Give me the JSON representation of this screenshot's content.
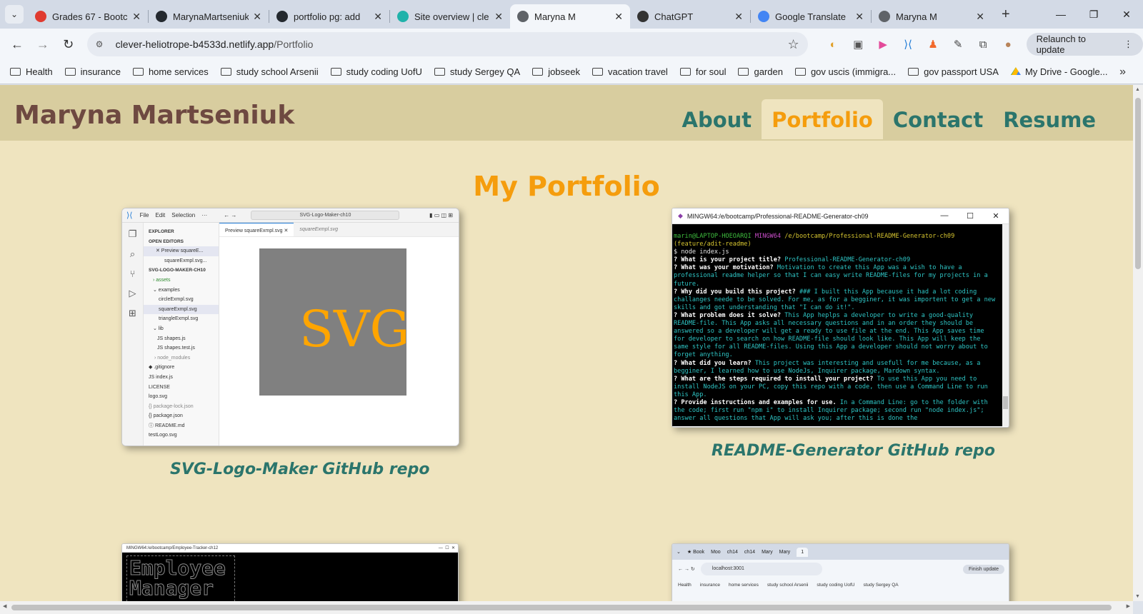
{
  "browser": {
    "tabs": [
      {
        "title": "Grades 67 - Bootc",
        "favicon_color": "#e03a2f",
        "active": false
      },
      {
        "title": "MarynaMartseniuk",
        "favicon_color": "#24292f",
        "active": false
      },
      {
        "title": "portfolio pg: add",
        "favicon_color": "#24292f",
        "active": false
      },
      {
        "title": "Site overview | cle",
        "favicon_color": "#20b2aa",
        "active": false
      },
      {
        "title": "Maryna M",
        "favicon_color": "#5f6368",
        "active": true
      },
      {
        "title": "ChatGPT",
        "favicon_color": "#333333",
        "active": false
      },
      {
        "title": "Google Translate",
        "favicon_color": "#4285f4",
        "active": false
      },
      {
        "title": "Maryna M",
        "favicon_color": "#5f6368",
        "active": false
      }
    ],
    "new_tab_icon": "plus-icon",
    "window_controls": {
      "minimize": "—",
      "restore": "❐",
      "close": "✕"
    },
    "url_host": "clever-heliotrope-b4533d.netlify.app",
    "url_path": "/Portfolio",
    "relaunch_label": "Relaunch to update",
    "bookmarks": [
      {
        "label": "Health",
        "type": "folder"
      },
      {
        "label": "insurance",
        "type": "folder"
      },
      {
        "label": "home services",
        "type": "folder"
      },
      {
        "label": "study school Arsenii",
        "type": "folder"
      },
      {
        "label": "study coding UofU",
        "type": "folder"
      },
      {
        "label": "study Sergey QA",
        "type": "folder"
      },
      {
        "label": "jobseek",
        "type": "folder"
      },
      {
        "label": "vacation travel",
        "type": "folder"
      },
      {
        "label": "for soul",
        "type": "folder"
      },
      {
        "label": "garden",
        "type": "folder"
      },
      {
        "label": "gov uscis (immigra...",
        "type": "folder"
      },
      {
        "label": "gov passport USA",
        "type": "folder"
      },
      {
        "label": "My Drive - Google...",
        "type": "drive"
      }
    ]
  },
  "site": {
    "name": "Maryna Martseniuk",
    "nav": [
      {
        "label": "About",
        "active": false
      },
      {
        "label": "Portfolio",
        "active": true
      },
      {
        "label": "Contact",
        "active": false
      },
      {
        "label": "Resume",
        "active": false
      }
    ],
    "page_title": "My Portfolio",
    "colors": {
      "header_bg": "#d8cd9f",
      "page_bg": "#efe4bf",
      "accent": "#f59d0d",
      "teal": "#2b756c",
      "name": "#6e4941"
    },
    "projects": [
      {
        "caption": "SVG-Logo-Maker GitHub repo",
        "vscode": {
          "menu": [
            "File",
            "Edit",
            "Selection",
            "···"
          ],
          "search": "SVG-Logo-Maker-ch10",
          "tab_active": "Preview squareExmpl.svg",
          "tab_inactive": "squareExmpl.svg",
          "explorer": [
            "EXPLORER",
            "OPEN EDITORS",
            "✕ Preview squareE...",
            "squareExmpl.svg...",
            "SVG-LOGO-MAKER-CH10",
            "› assets",
            "⌄ examples",
            "circleExmpl.svg",
            "squareExmpl.svg",
            "triangleExmpl.svg",
            "⌄ lib",
            "JS shapes.js",
            "JS shapes.test.js",
            "› node_modules",
            "◆ .gitignore",
            "JS index.js",
            "LICENSE",
            "logo.svg",
            "{} package-lock.json",
            "{} package.json",
            "ⓘ README.md",
            "testLogo.svg"
          ],
          "preview_text": "SVG"
        }
      },
      {
        "caption": "README-Generator GitHub repo",
        "terminal": {
          "title": "MINGW64:/e/bootcamp/Professional-README-Generator-ch09",
          "prompt_user": "marin@LAPTOP-HOEOARQI",
          "prompt_env": "MINGW64",
          "prompt_path": "/e/bootcamp/Professional-README-Generator-ch09 (feature/adit-readme)",
          "command": "$ node index.js",
          "qa": [
            {
              "q": "? What is your project title?",
              "a": "Professional-README-Generator-ch09"
            },
            {
              "q": "? What was your motivation?",
              "a": "Motivation to create this App was a wish to have a professional readme helper so that I can easy write README-files for my projects in a future."
            },
            {
              "q": "? Why did you build this project?",
              "a": "### I built this App because it had a lot coding challanges neede to be solved. For me, as for a begginer, it was importent to get a new skills and got understanding that \"I can do it!\"."
            },
            {
              "q": "? What problem does it solve?",
              "a": "This App heplps a developer to write a good-quality README-file. This App asks all necessary questions and in an order they should be answered so a developer will get a ready to use file at the end. This App saves time for developer to search on how README-file should look like. This App will keep the same style for all README-files. Using this App a developer should not worry about to forget anything."
            },
            {
              "q": "? What did you learn?",
              "a": "This project was interesting and usefull for me because, as a begginer, I learned how to use NodeJs, Inquirer package, Mardown syntax."
            },
            {
              "q": "? What are the steps required to install your project?",
              "a": "To use this App you need to install NodeJS on your PC, copy this repo with a code, then use a Command Line to run this App."
            },
            {
              "q": "? Provide instructions and examples for use.",
              "a": "In a Command Line: go to the folder with the code; first run \"npm i\" to install Inquirer package; second run \"node index.js\"; answer all questions that App will ask you; after this is done the"
            }
          ]
        }
      },
      {
        "caption": "",
        "employee": {
          "title": "MINGW64:/e/bootcamp/Employee-Tracker-ch12",
          "ascii": "Employee\nManager"
        }
      },
      {
        "caption": "",
        "browser_shot": {
          "tabs": [
            "★ Book",
            "Moo",
            "ch14",
            "ch14",
            "Mary",
            "Mary",
            "1"
          ],
          "url": "localhost:3001",
          "finish_update": "Finish update",
          "bookmarks": [
            "Health",
            "insurance",
            "home services",
            "study school Arsenii",
            "study coding UofU",
            "study Sergey QA"
          ]
        }
      }
    ]
  }
}
